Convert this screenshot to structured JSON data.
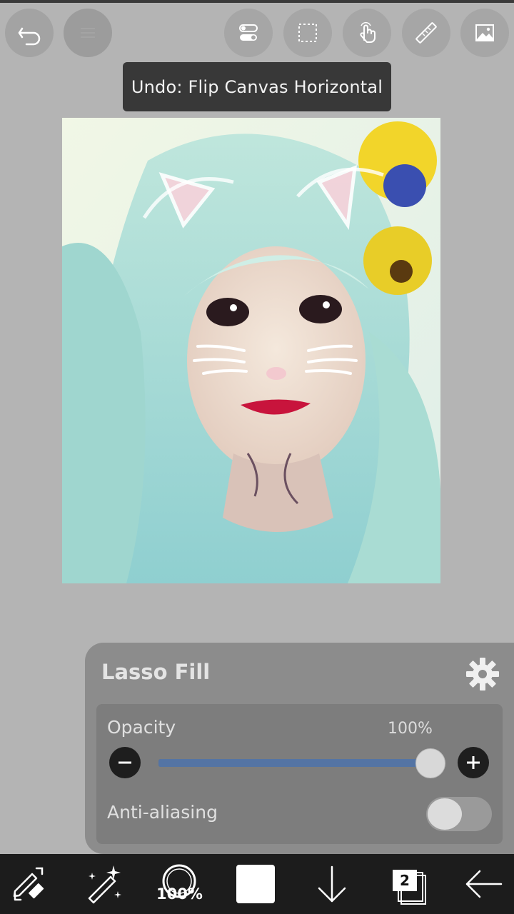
{
  "toolbar_top": {
    "buttons": [
      {
        "id": "undo",
        "icon": "undo-arrow-icon"
      },
      {
        "id": "menu",
        "icon": "menu-icon"
      },
      {
        "id": "toggle",
        "icon": "toggle-switches-icon"
      },
      {
        "id": "select",
        "icon": "selection-rectangle-icon"
      },
      {
        "id": "hand",
        "icon": "hand-touch-icon"
      },
      {
        "id": "ruler",
        "icon": "ruler-icon"
      },
      {
        "id": "gallery",
        "icon": "gallery-image-icon"
      }
    ]
  },
  "toast": {
    "text": "Undo: Flip Canvas Horizontal"
  },
  "canvas": {
    "content": "photo"
  },
  "tool_panel": {
    "title": "Lasso Fill",
    "settings_icon": "gear-icon",
    "opacity": {
      "label": "Opacity",
      "value_text": "100%",
      "value": 100
    },
    "anti_aliasing": {
      "label": "Anti-aliasing",
      "enabled": false
    }
  },
  "bottom_toolbar": {
    "items": [
      {
        "id": "pen-eraser",
        "icon": "pen-eraser-swap-icon"
      },
      {
        "id": "magic",
        "icon": "magic-wand-icon"
      },
      {
        "id": "brush",
        "icon": "brush-size-icon",
        "label": "100%"
      },
      {
        "id": "color",
        "icon": "color-swatch-icon",
        "color": "#ffffff"
      },
      {
        "id": "down",
        "icon": "arrow-down-icon"
      },
      {
        "id": "layers",
        "icon": "layers-icon",
        "label": "2"
      },
      {
        "id": "back",
        "icon": "arrow-left-icon"
      }
    ]
  },
  "colors": {
    "background": "#b4b4b4",
    "toast": "#383838",
    "panel": "#8c8c8c",
    "slider_fill": "#5474a4",
    "bottom_bar": "#1c1c1c"
  }
}
